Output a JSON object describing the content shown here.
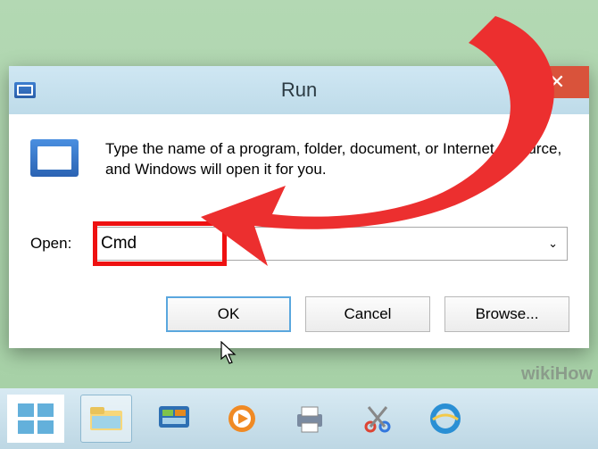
{
  "dialog": {
    "title": "Run",
    "instructions": "Type the name of a program, folder, document, or Internet resource, and Windows will open it for you.",
    "open_label": "Open:",
    "open_value": "Cmd",
    "buttons": {
      "ok": "OK",
      "cancel": "Cancel",
      "browse": "Browse..."
    }
  },
  "taskbar": {
    "items": [
      {
        "name": "start",
        "label": "Start"
      },
      {
        "name": "file-explorer",
        "label": "File Explorer",
        "active": true
      },
      {
        "name": "system-health",
        "label": "System Health"
      },
      {
        "name": "media-player",
        "label": "Windows Media Player"
      },
      {
        "name": "printer",
        "label": "Printer"
      },
      {
        "name": "snipping-tool",
        "label": "Snipping Tool"
      },
      {
        "name": "internet-explorer",
        "label": "Internet Explorer"
      }
    ]
  },
  "watermark": "wikiHow"
}
